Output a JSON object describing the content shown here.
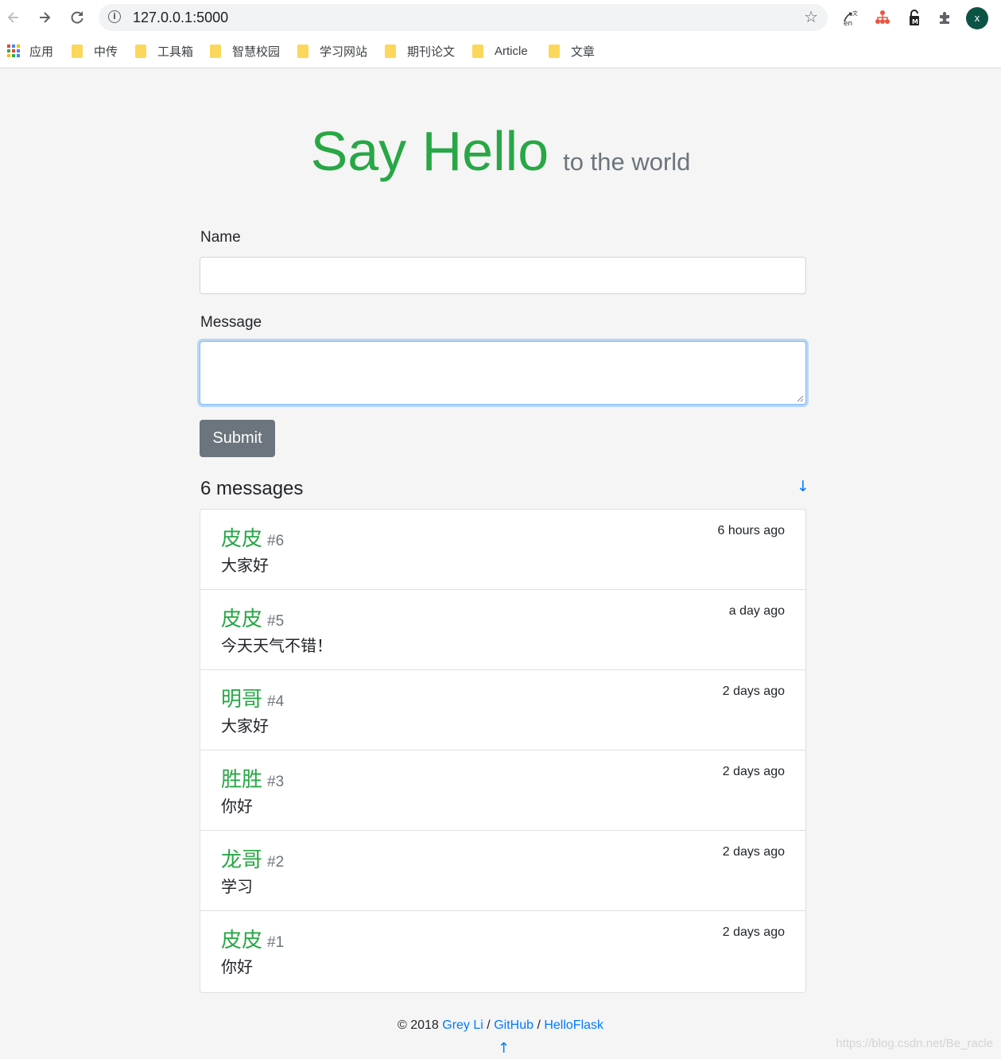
{
  "browser": {
    "url": "127.0.0.1:5000",
    "profile_initial": "x",
    "bookmarks": [
      {
        "label": "应用",
        "type": "apps"
      },
      {
        "label": "中传",
        "type": "folder"
      },
      {
        "label": "工具箱",
        "type": "folder"
      },
      {
        "label": "智慧校园",
        "type": "folder"
      },
      {
        "label": "学习网站",
        "type": "folder"
      },
      {
        "label": "期刊论文",
        "type": "folder"
      },
      {
        "label": "Article",
        "type": "folder"
      },
      {
        "label": "文章",
        "type": "folder"
      }
    ]
  },
  "header": {
    "title": "Say Hello",
    "subtitle": "to the world"
  },
  "form": {
    "name_label": "Name",
    "name_value": "",
    "message_label": "Message",
    "message_value": "",
    "submit_label": "Submit"
  },
  "messages": {
    "count_text": "6 messages",
    "scroll_down_glyph": "↓",
    "items": [
      {
        "name": "皮皮",
        "number": "#6",
        "time": "6 hours ago",
        "body": "大家好"
      },
      {
        "name": "皮皮",
        "number": "#5",
        "time": "a day ago",
        "body": "今天天气不错！"
      },
      {
        "name": "明哥",
        "number": "#4",
        "time": "2 days ago",
        "body": "大家好"
      },
      {
        "name": "胜胜",
        "number": "#3",
        "time": "2 days ago",
        "body": "你好"
      },
      {
        "name": "龙哥",
        "number": "#2",
        "time": "2 days ago",
        "body": "学习"
      },
      {
        "name": "皮皮",
        "number": "#1",
        "time": "2 days ago",
        "body": "你好"
      }
    ]
  },
  "footer": {
    "copyright": "© 2018",
    "author": "Grey Li",
    "sep": "/",
    "github": "GitHub",
    "helloflask": "HelloFlask",
    "scroll_up_glyph": "↑"
  },
  "watermark": "https://blog.csdn.net/Be_racle",
  "colors": {
    "accent_green": "#28a745",
    "link_blue": "#007bff",
    "muted": "#6c757d"
  }
}
